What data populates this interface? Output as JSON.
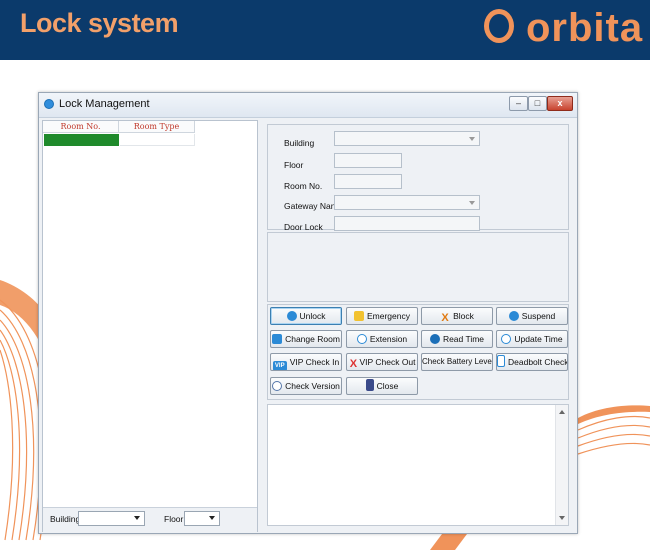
{
  "banner": {
    "title": "Lock system",
    "logo_text": "orbita"
  },
  "colors": {
    "banner_bg": "#0b3a6b",
    "accent_orange": "#f0935a",
    "selected_cell": "#1f8a2b"
  },
  "window": {
    "title": "Lock Management",
    "controls": {
      "minimize": "–",
      "maximize": "□",
      "close": "x"
    }
  },
  "room_table": {
    "columns": [
      "Room No.",
      "Room Type"
    ],
    "rows": [
      {
        "room_no": "",
        "room_type": ""
      }
    ]
  },
  "left_filter": {
    "building_label": "Building",
    "building_value": "",
    "floor_label": "Floor",
    "floor_value": ""
  },
  "form": {
    "building_label": "Building",
    "building_value": "",
    "floor_label": "Floor",
    "floor_value": "",
    "room_label": "Room No.",
    "room_value": "",
    "gateway_label": "Gateway Nan",
    "gateway_value": "",
    "doorlock_label": "Door Lock",
    "doorlock_value": ""
  },
  "buttons": {
    "unlock": "Unlock",
    "emergency": "Emergency",
    "block": "Block",
    "suspend": "Suspend",
    "change_room": "Change Room",
    "extension": "Extension",
    "read_time": "Read Time",
    "update_time": "Update Time",
    "vip_check_in": "VIP Check In",
    "vip_check_out": "VIP Check Out",
    "check_battery": "Check Battery Level",
    "deadbolt_check": "Deadbolt Check",
    "check_version": "Check Version",
    "close": "Close"
  },
  "icons": {
    "vip_badge": "VIP",
    "block_glyph": "X",
    "vip_out_glyph": "X"
  }
}
